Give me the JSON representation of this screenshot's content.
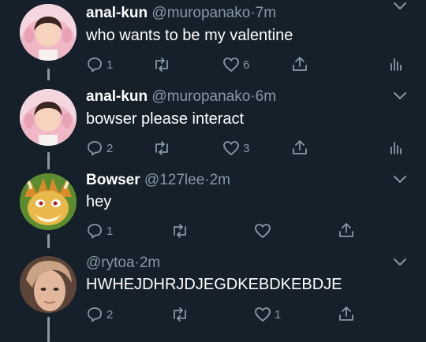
{
  "tweets": [
    {
      "name": "anal-kun",
      "handle": "@muropanako",
      "sep": "·",
      "time": "7m",
      "text": "who wants to be my valentine",
      "replies": "1",
      "retweets": "",
      "likes": "6",
      "avatar": "pink-bunny-hood"
    },
    {
      "name": "anal-kun",
      "handle": "@muropanako",
      "sep": "·",
      "time": "6m",
      "text": "bowser please interact",
      "replies": "2",
      "retweets": "",
      "likes": "3",
      "avatar": "pink-bunny-hood"
    },
    {
      "name": "Bowser",
      "handle": "@127lee",
      "sep": "·",
      "time": "2m",
      "text": "hey",
      "replies": "1",
      "retweets": "",
      "likes": "",
      "avatar": "bowser"
    },
    {
      "name": "",
      "handle": "@rytoa",
      "sep": "·",
      "time": "2m",
      "text": "HWHEJDHRJDJEGDKEBDKEBDJE",
      "replies": "2",
      "retweets": "",
      "likes": "1",
      "avatar": "person-photo"
    }
  ],
  "colors": {
    "background": "#15202b",
    "secondary": "#8899a6",
    "text": "#ffffff"
  }
}
